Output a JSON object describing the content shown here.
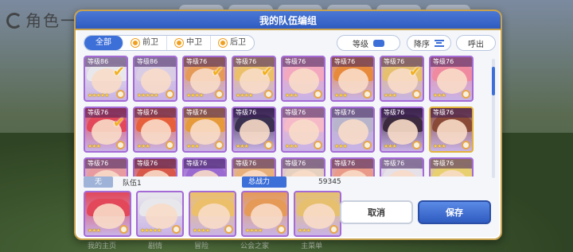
{
  "background": {
    "screen_title": "角色一览",
    "bottom_labels": [
      "我的主页",
      "剧情",
      "冒险",
      "公会之家",
      "主菜单"
    ]
  },
  "dialog": {
    "title": "我的队伍编组",
    "filters": [
      {
        "label": "全部",
        "active": true
      },
      {
        "label": "前卫",
        "active": false
      },
      {
        "label": "中卫",
        "active": false
      },
      {
        "label": "后卫",
        "active": false
      }
    ],
    "level_label": "等级",
    "sort_label": "降序",
    "call_label": "呼出"
  },
  "roster": [
    {
      "level": "等级86",
      "stars": "★★★★★",
      "selected": true,
      "hair": "#e8e8ec",
      "rarity": "purple"
    },
    {
      "level": "等级86",
      "stars": "★★★★★",
      "selected": false,
      "hair": "#d9cde6",
      "rarity": "purple"
    },
    {
      "level": "等级76",
      "stars": "★★★★",
      "selected": true,
      "hair": "#e59a58",
      "rarity": "purple"
    },
    {
      "level": "等级76",
      "stars": "★★★★",
      "selected": true,
      "hair": "#ecc06a",
      "rarity": "purple"
    },
    {
      "level": "等级76",
      "stars": "★★★",
      "selected": false,
      "hair": "#f3a8bf",
      "rarity": "purple"
    },
    {
      "level": "等级76",
      "stars": "★★★",
      "selected": false,
      "hair": "#e88a3c",
      "rarity": "purple"
    },
    {
      "level": "等级76",
      "stars": "★★★",
      "selected": true,
      "hair": "#e6c06e",
      "rarity": "purple"
    },
    {
      "level": "等级76",
      "stars": "★★★",
      "selected": false,
      "hair": "#ef8aa0",
      "rarity": "purple"
    },
    {
      "level": "等级76",
      "stars": "★★★",
      "selected": true,
      "hair": "#e2485a",
      "rarity": "purple"
    },
    {
      "level": "等级76",
      "stars": "★★★",
      "selected": false,
      "hair": "#e7603c",
      "rarity": "purple"
    },
    {
      "level": "等级76",
      "stars": "★★★",
      "selected": false,
      "hair": "#e69a3a",
      "rarity": "purple"
    },
    {
      "level": "等级76",
      "stars": "★★★",
      "selected": false,
      "hair": "#3a3050",
      "rarity": "purple"
    },
    {
      "level": "等级76",
      "stars": "★★★",
      "selected": false,
      "hair": "#f6b9c8",
      "rarity": "purple"
    },
    {
      "level": "等级76",
      "stars": "★★★",
      "selected": false,
      "hair": "#b8b4cc",
      "rarity": "purple"
    },
    {
      "level": "等级76",
      "stars": "★★★",
      "selected": false,
      "hair": "#3c2a3e",
      "rarity": "purple"
    },
    {
      "level": "等级76",
      "stars": "★★★",
      "selected": false,
      "hair": "#8a4a38",
      "rarity": "gold"
    },
    {
      "level": "等级76",
      "stars": "",
      "selected": false,
      "hair": "#e79aa0",
      "rarity": "purple"
    },
    {
      "level": "等级76",
      "stars": "",
      "selected": false,
      "hair": "#d8584a",
      "rarity": "purple"
    },
    {
      "level": "等级76",
      "stars": "",
      "selected": false,
      "hair": "#9a6ad0",
      "rarity": "purple"
    },
    {
      "level": "等级76",
      "stars": "",
      "selected": false,
      "hair": "#e7b07a",
      "rarity": "purple"
    },
    {
      "level": "等级76",
      "stars": "",
      "selected": false,
      "hair": "#e6d0c0",
      "rarity": "purple"
    },
    {
      "level": "等级76",
      "stars": "",
      "selected": false,
      "hair": "#e99a88",
      "rarity": "purple"
    },
    {
      "level": "等级76",
      "stars": "",
      "selected": false,
      "hair": "#e6e0e8",
      "rarity": "purple"
    },
    {
      "level": "等级76",
      "stars": "",
      "selected": false,
      "hair": "#e8d070",
      "rarity": "purple"
    }
  ],
  "team": {
    "tag": "无",
    "name": "队伍1",
    "power_label": "总战力",
    "power_value": "59345",
    "members": [
      {
        "stars": "★★★",
        "hair": "#e2485a"
      },
      {
        "stars": "★★★★★",
        "hair": "#e8e8ec"
      },
      {
        "stars": "★★★★",
        "hair": "#ecc06a"
      },
      {
        "stars": "★★★★",
        "hair": "#e59a58"
      },
      {
        "stars": "★★★",
        "hair": "#e6c06e"
      }
    ]
  },
  "buttons": {
    "cancel": "取消",
    "save": "保存"
  },
  "colors": {
    "accent": "#3d6fd8",
    "frame_gold": "#c8a24e",
    "card_purple": "#a46ad6",
    "star": "#ffd23a"
  }
}
